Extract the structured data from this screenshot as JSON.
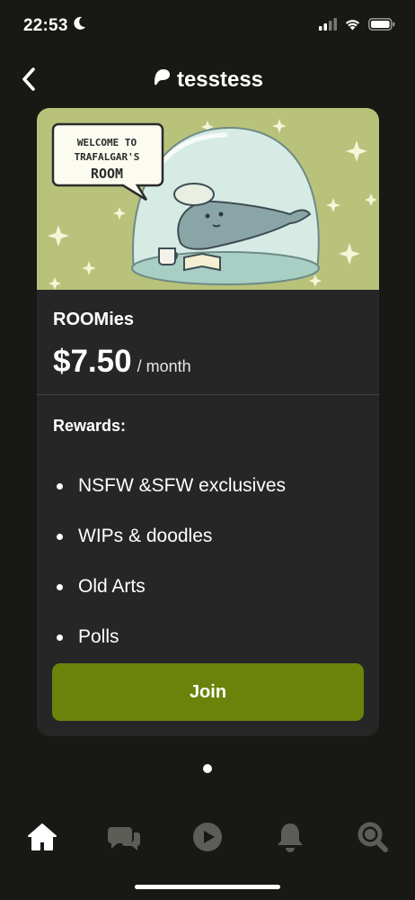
{
  "status_bar": {
    "time": "22:53"
  },
  "header": {
    "title": "tesstess"
  },
  "tier": {
    "banner_lettering": [
      "WELCOME TO",
      "TRAFALGAR'S",
      "ROOM"
    ],
    "name": "ROOMies",
    "price": "$7.50",
    "period": "/ month",
    "rewards_title": "Rewards:",
    "rewards": [
      "NSFW &SFW exclusives",
      "WIPs & doodles",
      "Old Arts",
      "Polls"
    ],
    "join_label": "Join"
  },
  "pagination": {
    "current": 1,
    "total": 1
  },
  "tab_bar": {
    "items": [
      "home-icon",
      "chat-icon",
      "play-icon",
      "bell-icon",
      "search-icon"
    ],
    "active": "home-icon"
  },
  "colors": {
    "background": "#181814",
    "card": "#262626",
    "accent": "#6b830b",
    "tab_inactive": "#5d5d58"
  }
}
